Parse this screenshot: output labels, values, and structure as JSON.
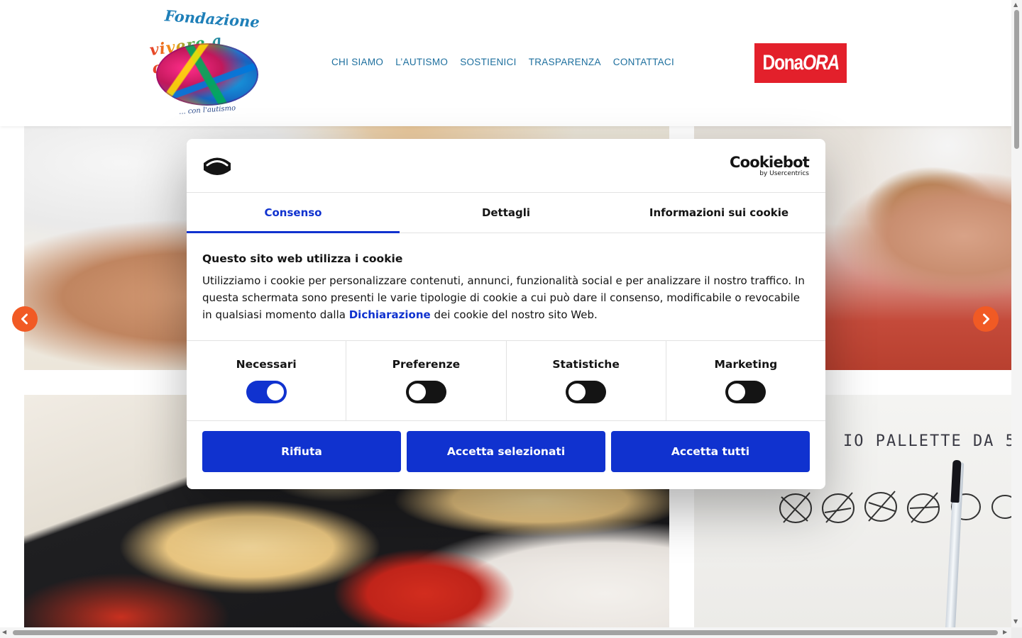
{
  "header": {
    "logo": {
      "line1": "Fondazione",
      "line2": "vivere a colori",
      "tagline": "... con l'autismo"
    },
    "nav": [
      {
        "label": "CHI SIAMO"
      },
      {
        "label": "L’AUTISMO"
      },
      {
        "label": "SOSTIENICI"
      },
      {
        "label": "TRASPARENZA"
      },
      {
        "label": "CONTATTACI"
      }
    ],
    "donate": {
      "part1": "Dona",
      "part2": "ORA",
      "color": "#e3202b"
    }
  },
  "gallery": {
    "board_text": "IO PALLETTE DA 5",
    "arrow_color": "#f15a24"
  },
  "cookie_dialog": {
    "brand": {
      "name": "Cookiebot",
      "sub": "by Usercentrics"
    },
    "tabs": [
      {
        "label": "Consenso",
        "active": true
      },
      {
        "label": "Dettagli",
        "active": false
      },
      {
        "label": "Informazioni sui cookie",
        "active": false
      }
    ],
    "title": "Questo sito web utilizza i cookie",
    "text_before_link": "Utilizziamo i cookie per personalizzare contenuti, annunci, funzionalità social e per analizzare il nostro traffico. In questa schermata sono presenti le varie tipologie di cookie a cui può dare il consenso, modificabile o revocabile in qualsiasi momento dalla ",
    "link_text": "Dichiarazione",
    "text_after_link": " dei cookie del nostro sito Web.",
    "toggles": [
      {
        "label": "Necessari",
        "checked": true
      },
      {
        "label": "Preferenze",
        "checked": false
      },
      {
        "label": "Statistiche",
        "checked": false
      },
      {
        "label": "Marketing",
        "checked": false
      }
    ],
    "buttons": {
      "reject": "Rifiuta",
      "accept_selected": "Accetta selezionati",
      "accept_all": "Accetta tutti"
    },
    "accent_color": "#1032cf"
  }
}
